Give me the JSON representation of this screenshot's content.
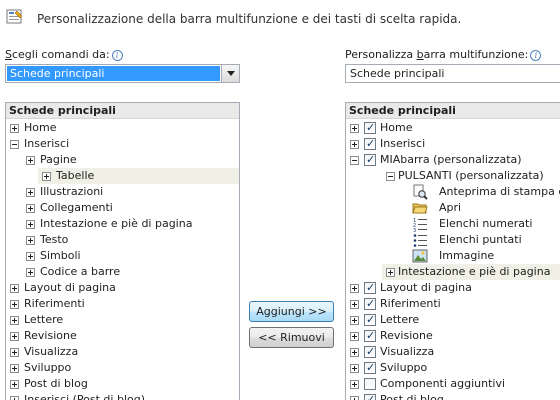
{
  "header": {
    "title": "Personalizzazione della barra multifunzione e dei tasti di scelta rapida."
  },
  "left": {
    "label_prefix": "S",
    "label_rest": "cegli comandi da:",
    "combo_value": "Schede principali",
    "list_header": "Schede principali",
    "items": [
      {
        "text": "Home",
        "level": 0,
        "expander": "plus"
      },
      {
        "text": "Inserisci",
        "level": 0,
        "expander": "minus"
      },
      {
        "text": "Pagine",
        "level": 1,
        "expander": "plus"
      },
      {
        "text": "Tabelle",
        "level": 1,
        "expander": "plus",
        "selected": true
      },
      {
        "text": "Illustrazioni",
        "level": 1,
        "expander": "plus"
      },
      {
        "text": "Collegamenti",
        "level": 1,
        "expander": "plus"
      },
      {
        "text": "Intestazione e piè di pagina",
        "level": 1,
        "expander": "plus"
      },
      {
        "text": "Testo",
        "level": 1,
        "expander": "plus"
      },
      {
        "text": "Simboli",
        "level": 1,
        "expander": "plus"
      },
      {
        "text": "Codice a barre",
        "level": 1,
        "expander": "plus"
      },
      {
        "text": "Layout di pagina",
        "level": 0,
        "expander": "plus"
      },
      {
        "text": "Riferimenti",
        "level": 0,
        "expander": "plus"
      },
      {
        "text": "Lettere",
        "level": 0,
        "expander": "plus"
      },
      {
        "text": "Revisione",
        "level": 0,
        "expander": "plus"
      },
      {
        "text": "Visualizza",
        "level": 0,
        "expander": "plus"
      },
      {
        "text": "Sviluppo",
        "level": 0,
        "expander": "plus"
      },
      {
        "text": "Post di blog",
        "level": 0,
        "expander": "plus"
      },
      {
        "text": "Inserisci (Post di blog)",
        "level": 0,
        "expander": "plus"
      }
    ]
  },
  "right": {
    "label_prefix": "Personalizza ",
    "label_u": "b",
    "label_rest": "arra multifunzione:",
    "combo_value": "Schede principali",
    "list_header": "Schede principali",
    "items": [
      {
        "text": "Home",
        "kind": "tab",
        "expander": "plus",
        "checked": true
      },
      {
        "text": "Inserisci",
        "kind": "tab",
        "expander": "plus",
        "checked": true
      },
      {
        "text": "MIAbarra (personalizzata)",
        "kind": "tab",
        "expander": "minus",
        "checked": true
      },
      {
        "text": "PULSANTI (personalizzata)",
        "kind": "group",
        "expander": "minus"
      },
      {
        "text": "Anteprima di stampa e s",
        "kind": "cmd",
        "icon": "print-preview-icon"
      },
      {
        "text": "Apri",
        "kind": "cmd",
        "icon": "open-folder-icon"
      },
      {
        "text": "Elenchi numerati",
        "kind": "cmd",
        "icon": "numbered-list-icon"
      },
      {
        "text": "Elenchi puntati",
        "kind": "cmd",
        "icon": "bulleted-list-icon"
      },
      {
        "text": "Immagine",
        "kind": "cmd",
        "icon": "picture-icon"
      },
      {
        "text": "Intestazione e piè di pagina",
        "kind": "group",
        "expander": "plus",
        "selected": true
      },
      {
        "text": "Layout di pagina",
        "kind": "tab",
        "expander": "plus",
        "checked": true
      },
      {
        "text": "Riferimenti",
        "kind": "tab",
        "expander": "plus",
        "checked": true
      },
      {
        "text": "Lettere",
        "kind": "tab",
        "expander": "plus",
        "checked": true
      },
      {
        "text": "Revisione",
        "kind": "tab",
        "expander": "plus",
        "checked": true
      },
      {
        "text": "Visualizza",
        "kind": "tab",
        "expander": "plus",
        "checked": true
      },
      {
        "text": "Sviluppo",
        "kind": "tab",
        "expander": "plus",
        "checked": true
      },
      {
        "text": "Componenti aggiuntivi",
        "kind": "tab",
        "expander": "plus",
        "checked": false
      },
      {
        "text": "Post di blog",
        "kind": "tab",
        "expander": "plus",
        "checked": true
      }
    ]
  },
  "buttons": {
    "add": "Aggiungi >>",
    "remove": "<< Rimuovi"
  }
}
